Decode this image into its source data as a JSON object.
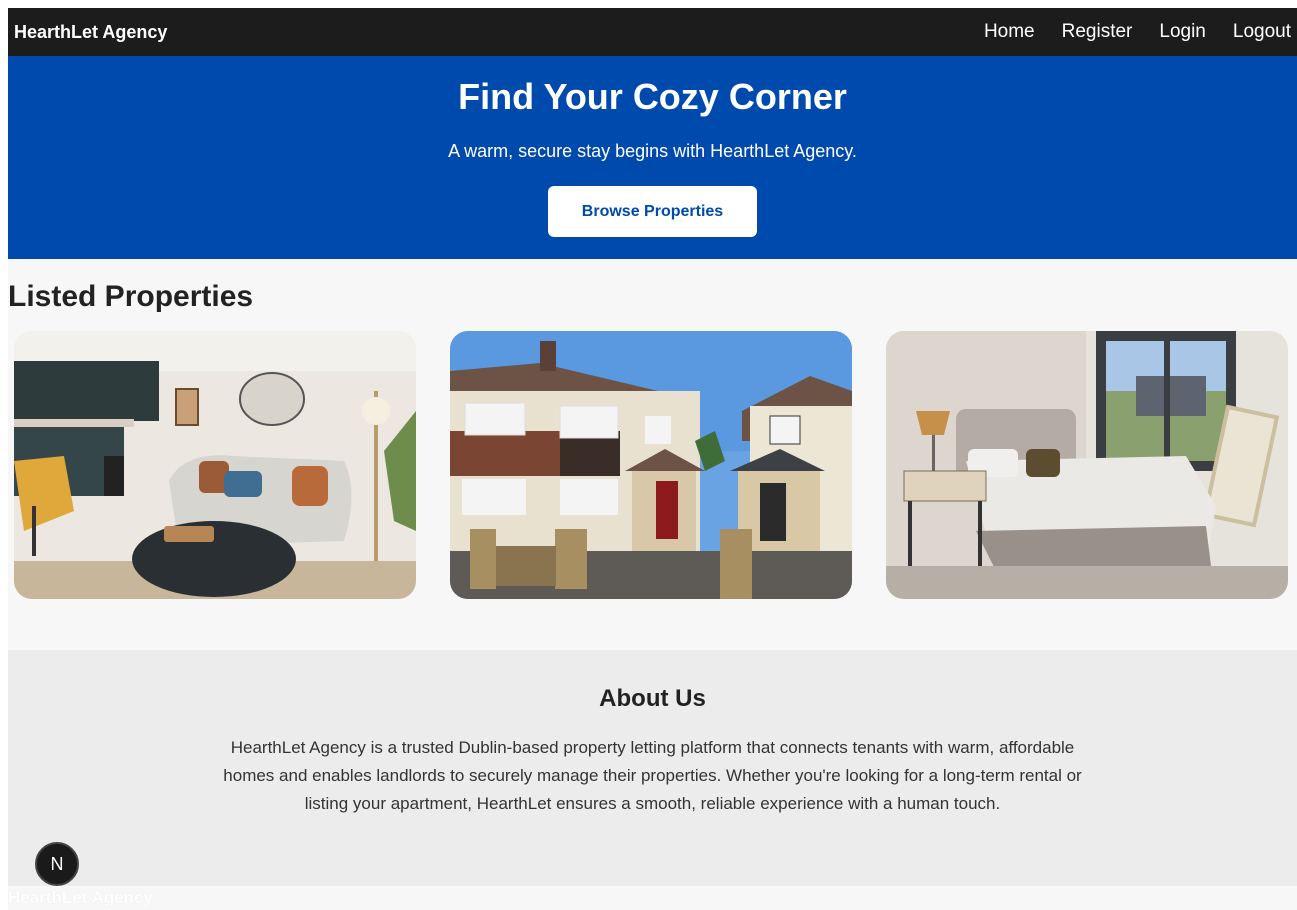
{
  "navbar": {
    "brand": "HearthLet Agency",
    "links": [
      {
        "label": "Home"
      },
      {
        "label": "Register"
      },
      {
        "label": "Login"
      },
      {
        "label": "Logout"
      }
    ]
  },
  "hero": {
    "title": "Find Your Cozy Corner",
    "subtitle": "A warm, secure stay begins with HearthLet Agency.",
    "button_label": "Browse Properties",
    "background_color": "#004aad"
  },
  "listings": {
    "title": "Listed Properties",
    "properties": [
      {
        "image": "living-room-kitchen-photo"
      },
      {
        "image": "semi-detached-house-photo"
      },
      {
        "image": "bedroom-photo"
      }
    ]
  },
  "about": {
    "title": "About Us",
    "text": "HearthLet Agency is a trusted Dublin-based property letting platform that connects tenants with warm, affordable homes and enables landlords to securely manage their properties. Whether you're looking for a long-term rental or listing your apartment, HearthLet ensures a smooth, reliable experience with a human touch."
  },
  "footer": {
    "text": "HearthLet Agency"
  },
  "dev_badge": {
    "label": "N"
  }
}
